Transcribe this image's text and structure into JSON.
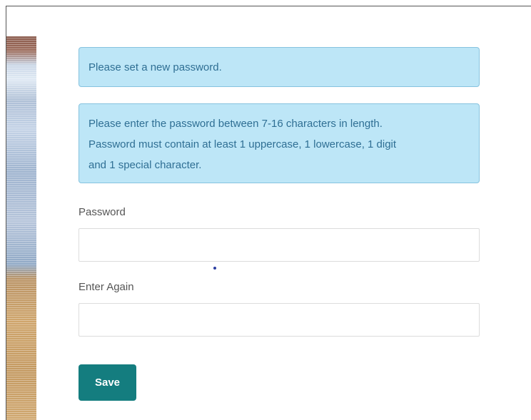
{
  "notice": {
    "set_password": "Please set a new password.",
    "rules_line1": "Please enter the password between 7-16 characters in length.",
    "rules_line2": "Password must contain at least 1 uppercase, 1 lowercase, 1 digit",
    "rules_line3": "and 1 special character."
  },
  "form": {
    "password_label": "Password",
    "password_value": "",
    "confirm_label": "Enter Again",
    "confirm_value": "",
    "save_label": "Save"
  },
  "colors": {
    "alert_bg": "#bde6f7",
    "alert_text": "#2f6f94",
    "save_bg": "#147d7f"
  }
}
